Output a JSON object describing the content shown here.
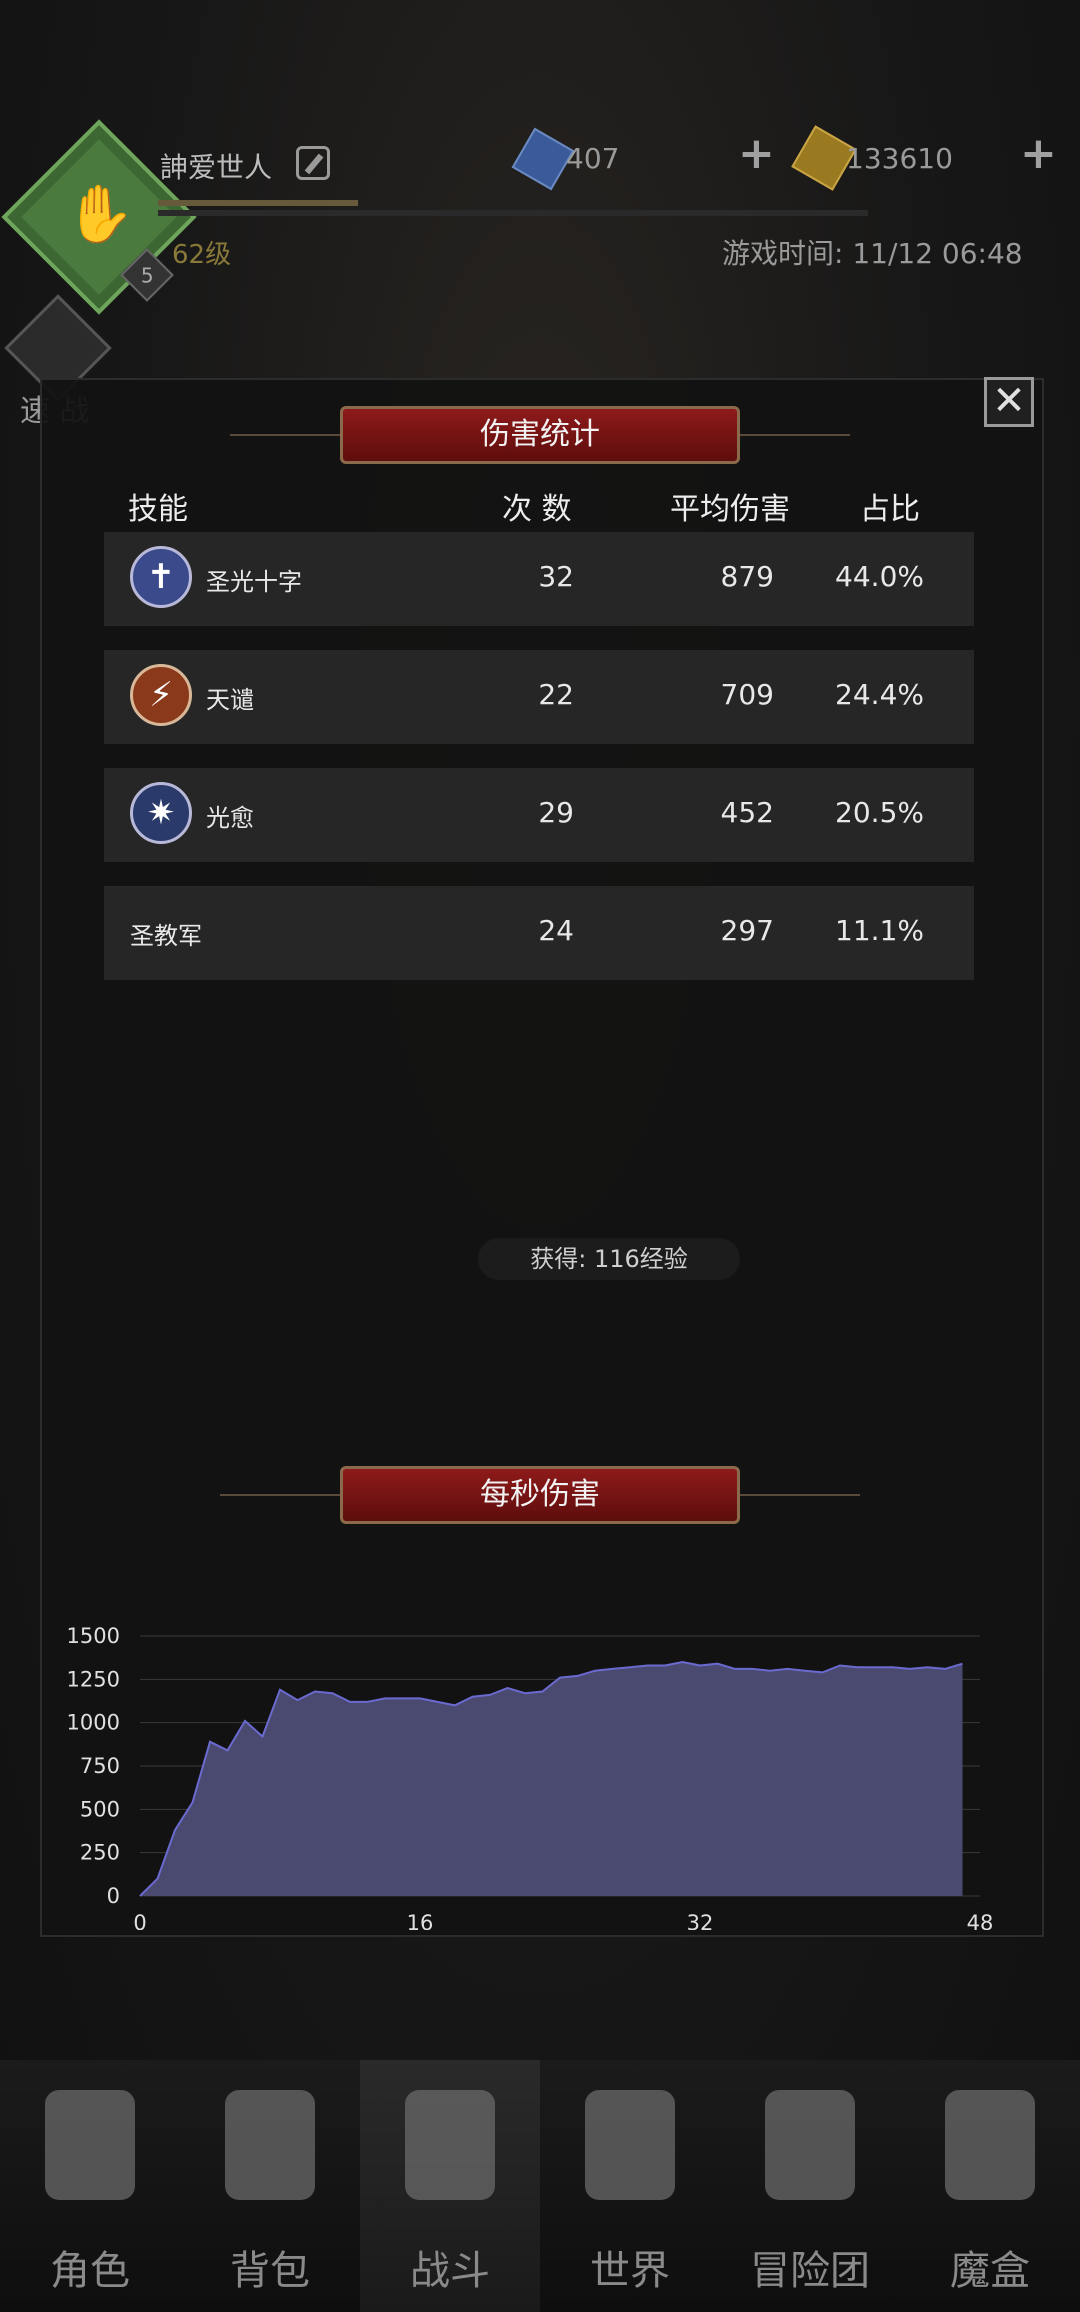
{
  "status_bar": {
    "username": "訷爱世人",
    "level": "62级",
    "avatar_badge": "5",
    "gems": "407",
    "coins": "133610",
    "game_time": "游戏时间: 11/12 06:48",
    "quick_battle_label": "速 战"
  },
  "damage_stats": {
    "title": "伤害统计",
    "columns": {
      "skill": "技能",
      "count": "次 数",
      "avg": "平均伤害",
      "pct": "占比"
    },
    "rows": [
      {
        "name": "圣光十字",
        "icon": "holy-cross-icon",
        "count": "32",
        "avg": "879",
        "pct": "44.0%"
      },
      {
        "name": "天谴",
        "icon": "divine-wrath-icon",
        "count": "22",
        "avg": "709",
        "pct": "24.4%"
      },
      {
        "name": "光愈",
        "icon": "light-heal-icon",
        "count": "29",
        "avg": "452",
        "pct": "20.5%"
      },
      {
        "name": "圣教军",
        "icon": "",
        "count": "24",
        "avg": "297",
        "pct": "11.1%"
      }
    ]
  },
  "reward": {
    "exp_text": "获得: 116经验"
  },
  "dps": {
    "title": "每秒伤害"
  },
  "chart_data": {
    "type": "area",
    "x": [
      0,
      1,
      2,
      3,
      4,
      5,
      6,
      7,
      8,
      9,
      10,
      11,
      12,
      13,
      14,
      15,
      16,
      17,
      18,
      19,
      20,
      21,
      22,
      23,
      24,
      25,
      26,
      27,
      28,
      29,
      30,
      31,
      32,
      33,
      34,
      35,
      36,
      37,
      38,
      39,
      40,
      41,
      42,
      43,
      44,
      45,
      46,
      47
    ],
    "values": [
      0,
      100,
      380,
      540,
      890,
      840,
      1010,
      920,
      1190,
      1130,
      1180,
      1170,
      1120,
      1120,
      1140,
      1140,
      1140,
      1120,
      1100,
      1150,
      1160,
      1200,
      1170,
      1180,
      1260,
      1270,
      1300,
      1310,
      1320,
      1330,
      1330,
      1350,
      1330,
      1340,
      1310,
      1310,
      1300,
      1310,
      1300,
      1290,
      1330,
      1320,
      1320,
      1320,
      1310,
      1320,
      1310,
      1340
    ],
    "xticks": [
      "0",
      "16",
      "32",
      "48"
    ],
    "yticks": [
      "0",
      "250",
      "500",
      "750",
      "1000",
      "1250",
      "1500"
    ],
    "xlim": [
      0,
      48
    ],
    "ylim": [
      0,
      1500
    ],
    "grid": true,
    "fill_color": "#4a4a70",
    "line_color": "#6a6ad0"
  },
  "bottom_nav": [
    {
      "label": "角色",
      "icon": "knight-helmet-icon"
    },
    {
      "label": "背包",
      "icon": "backpack-icon"
    },
    {
      "label": "战斗",
      "icon": "sword-shield-icon",
      "active": true
    },
    {
      "label": "世界",
      "icon": "scroll-map-icon"
    },
    {
      "label": "冒险团",
      "icon": "castle-icon"
    },
    {
      "label": "魔盒",
      "icon": "magic-cube-icon"
    }
  ]
}
